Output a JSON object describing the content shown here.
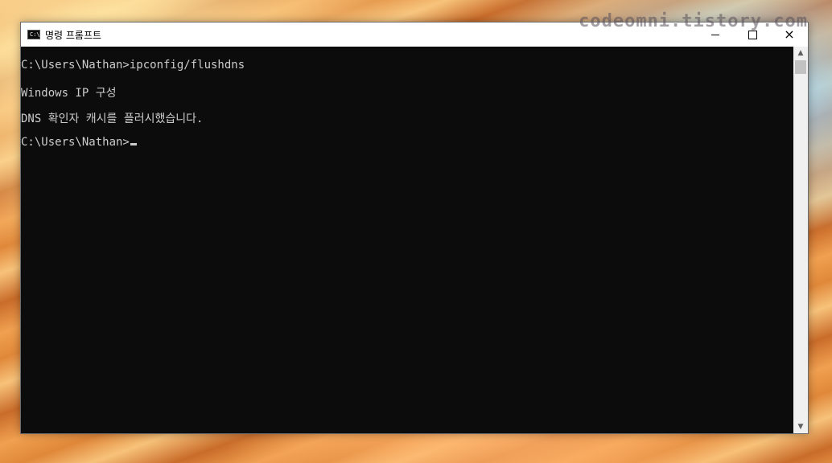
{
  "watermark": "codeomni.tistory.com",
  "window": {
    "title": "명령 프롬프트",
    "icon": "cmd-icon",
    "icon_text": "C:\\",
    "controls": {
      "minimize": "minimize-icon",
      "maximize": "maximize-icon",
      "close": "×"
    }
  },
  "console": {
    "lines": [
      "C:\\Users\\Nathan>ipconfig/flushdns",
      "Windows IP 구성",
      "DNS 확인자 캐시를 플러시했습니다.",
      "C:\\Users\\Nathan>"
    ]
  },
  "scrollbar": {
    "up": "▲",
    "down": "▼"
  },
  "colors": {
    "console_bg": "#0c0c0c",
    "console_text": "#cccccc",
    "titlebar_bg": "#ffffff"
  }
}
